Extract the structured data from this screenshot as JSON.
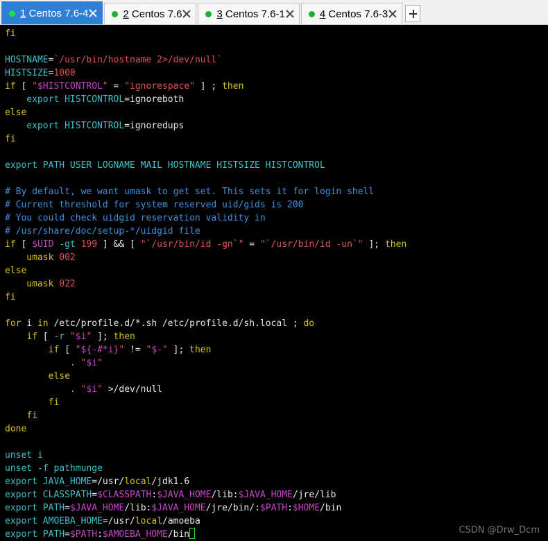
{
  "tabs": [
    {
      "num": "1",
      "title": " Centos 7.6-4",
      "active": true
    },
    {
      "num": "2",
      "title": " Centos 7.6",
      "active": false
    },
    {
      "num": "3",
      "title": " Centos 7.6-1",
      "active": false
    },
    {
      "num": "4",
      "title": " Centos 7.6-3",
      "active": false
    }
  ],
  "colors": {
    "keyword": "#d6c21a",
    "variable": "#3ec0c8",
    "string": "#e05252",
    "comment": "#3d8fe0",
    "special": "#c842c8",
    "active_tab": "#2f7fd8",
    "status_dot": "#16b23a"
  },
  "terminal_lines": [
    [
      [
        "fi",
        "kw"
      ]
    ],
    [],
    [
      [
        "HOSTNAME",
        "var"
      ],
      [
        "=",
        ""
      ],
      [
        "`/usr/bin/hostname 2>/dev/null`",
        "str"
      ]
    ],
    [
      [
        "HISTSIZE",
        "var"
      ],
      [
        "=",
        ""
      ],
      [
        "1000",
        "str"
      ]
    ],
    [
      [
        "if",
        "kw"
      ],
      [
        " [ ",
        ""
      ],
      [
        "\"",
        "str"
      ],
      [
        "$HISTCONTROL",
        "mag"
      ],
      [
        "\"",
        "str"
      ],
      [
        " = ",
        ""
      ],
      [
        "\"ignorespace\"",
        "str"
      ],
      [
        " ] ; ",
        ""
      ],
      [
        "then",
        "kw"
      ]
    ],
    [
      [
        "    export ",
        "var"
      ],
      [
        "HISTCONTROL",
        "var"
      ],
      [
        "=ignoreboth",
        ""
      ]
    ],
    [
      [
        "else",
        "kw"
      ]
    ],
    [
      [
        "    export ",
        "var"
      ],
      [
        "HISTCONTROL",
        "var"
      ],
      [
        "=ignoredups",
        ""
      ]
    ],
    [
      [
        "fi",
        "kw"
      ]
    ],
    [],
    [
      [
        "export PATH USER LOGNAME MAIL HOSTNAME HISTSIZE HISTCONTROL",
        "var"
      ]
    ],
    [],
    [
      [
        "# By default, we want umask to get set. This sets it for login shell",
        "cmt"
      ]
    ],
    [
      [
        "# Current threshold for system reserved uid/gids is 200",
        "cmt"
      ]
    ],
    [
      [
        "# You could check uidgid reservation validity in",
        "cmt"
      ]
    ],
    [
      [
        "# /usr/share/doc/setup-*/uidgid file",
        "cmt"
      ]
    ],
    [
      [
        "if",
        "kw"
      ],
      [
        " [ ",
        ""
      ],
      [
        "$UID",
        "mag"
      ],
      [
        " -gt ",
        "var"
      ],
      [
        "199",
        "str"
      ],
      [
        " ] && [ ",
        ""
      ],
      [
        "\"`/usr/bin/id -gn`\"",
        "str"
      ],
      [
        " = ",
        ""
      ],
      [
        "\"`/usr/bin/id -un`\"",
        "str"
      ],
      [
        " ]; ",
        ""
      ],
      [
        "then",
        "kw"
      ]
    ],
    [
      [
        "    umask ",
        "kw"
      ],
      [
        "002",
        "str"
      ]
    ],
    [
      [
        "else",
        "kw"
      ]
    ],
    [
      [
        "    umask ",
        "kw"
      ],
      [
        "022",
        "str"
      ]
    ],
    [
      [
        "fi",
        "kw"
      ]
    ],
    [],
    [
      [
        "for",
        "kw"
      ],
      [
        " i ",
        ""
      ],
      [
        "in",
        "kw"
      ],
      [
        " /etc/profile.d/*.sh /etc/profile.d/sh.local ; ",
        ""
      ],
      [
        "do",
        "kw"
      ]
    ],
    [
      [
        "    ",
        ""
      ],
      [
        "if",
        "kw"
      ],
      [
        " [ ",
        ""
      ],
      [
        "-r ",
        "var"
      ],
      [
        "\"",
        "str"
      ],
      [
        "$i",
        "mag"
      ],
      [
        "\"",
        "str"
      ],
      [
        " ]; ",
        ""
      ],
      [
        "then",
        "kw"
      ]
    ],
    [
      [
        "        ",
        ""
      ],
      [
        "if",
        "kw"
      ],
      [
        " [ ",
        ""
      ],
      [
        "\"",
        "str"
      ],
      [
        "${-#*i}",
        "mag"
      ],
      [
        "\"",
        "str"
      ],
      [
        " != ",
        ""
      ],
      [
        "\"",
        "str"
      ],
      [
        "$-",
        "mag"
      ],
      [
        "\"",
        "str"
      ],
      [
        " ]; ",
        ""
      ],
      [
        "then",
        "kw"
      ]
    ],
    [
      [
        "            . ",
        "var"
      ],
      [
        "\"",
        "str"
      ],
      [
        "$i",
        "mag"
      ],
      [
        "\"",
        "str"
      ]
    ],
    [
      [
        "        ",
        ""
      ],
      [
        "else",
        "kw"
      ]
    ],
    [
      [
        "            . ",
        "var"
      ],
      [
        "\"",
        "str"
      ],
      [
        "$i",
        "mag"
      ],
      [
        "\"",
        "str"
      ],
      [
        " >/dev/null",
        ""
      ]
    ],
    [
      [
        "        ",
        ""
      ],
      [
        "fi",
        "kw"
      ]
    ],
    [
      [
        "    ",
        ""
      ],
      [
        "fi",
        "kw"
      ]
    ],
    [
      [
        "done",
        "kw"
      ]
    ],
    [],
    [
      [
        "unset i",
        "var"
      ]
    ],
    [
      [
        "unset -f ",
        "var"
      ],
      [
        "pathmunge",
        "var"
      ]
    ],
    [
      [
        "export ",
        "var"
      ],
      [
        "JAVA_HOME",
        "var"
      ],
      [
        "=/usr/",
        ""
      ],
      [
        "local",
        "kw"
      ],
      [
        "/jdk1.6",
        ""
      ]
    ],
    [
      [
        "export ",
        "var"
      ],
      [
        "CLASSPATH",
        "var"
      ],
      [
        "=",
        ""
      ],
      [
        "$CLASSPATH",
        "mag"
      ],
      [
        ":",
        ""
      ],
      [
        "$JAVA_HOME",
        "mag"
      ],
      [
        "/lib:",
        ""
      ],
      [
        "$JAVA_HOME",
        "mag"
      ],
      [
        "/jre/lib",
        ""
      ]
    ],
    [
      [
        "export ",
        "var"
      ],
      [
        "PATH",
        "var"
      ],
      [
        "=",
        ""
      ],
      [
        "$JAVA_HOME",
        "mag"
      ],
      [
        "/lib:",
        ""
      ],
      [
        "$JAVA_HOME",
        "mag"
      ],
      [
        "/jre/bin/:",
        ""
      ],
      [
        "$PATH",
        "mag"
      ],
      [
        ":",
        ""
      ],
      [
        "$HOME",
        "mag"
      ],
      [
        "/bin",
        ""
      ]
    ],
    [
      [
        "export ",
        "var"
      ],
      [
        "AMOEBA_HOME",
        "var"
      ],
      [
        "=/usr/",
        ""
      ],
      [
        "local",
        "kw"
      ],
      [
        "/amoeba",
        ""
      ]
    ],
    [
      [
        "export ",
        "var"
      ],
      [
        "PATH",
        "var"
      ],
      [
        "=",
        ""
      ],
      [
        "$PATH",
        "mag"
      ],
      [
        ":",
        ""
      ],
      [
        "$AMOEBA_HOME",
        "mag"
      ],
      [
        "/bin",
        ""
      ]
    ]
  ],
  "watermark": "CSDN @Drw_Dcm"
}
